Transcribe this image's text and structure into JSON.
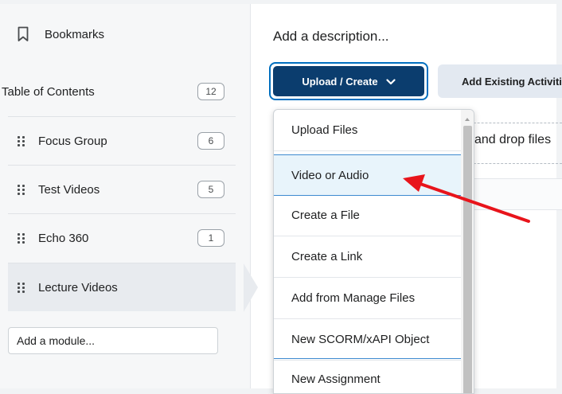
{
  "sidebar": {
    "bookmarks_label": "Bookmarks",
    "toc": {
      "label": "Table of Contents",
      "count": "12"
    },
    "modules": [
      {
        "label": "Focus Group",
        "count": "6"
      },
      {
        "label": "Test Videos",
        "count": "5"
      },
      {
        "label": "Echo 360",
        "count": "1"
      },
      {
        "label": "Lecture Videos",
        "count": ""
      }
    ],
    "add_module_placeholder": "Add a module..."
  },
  "main": {
    "description_placeholder": "Add a description...",
    "upload_create_label": "Upload / Create",
    "add_existing_label": "Add Existing Activities",
    "drop_hint": "and drop files"
  },
  "dropdown": {
    "items": [
      "Upload Files",
      "Video or Audio",
      "Create a File",
      "Create a Link",
      "Add from Manage Files",
      "New SCORM/xAPI Object",
      "New Assignment"
    ],
    "highlighted": "Video or Audio"
  },
  "colors": {
    "primary_button": "#0b3d6e",
    "focus_ring": "#006fbf",
    "annotation_arrow": "#e8141b",
    "highlight_bg": "#e8f4fb"
  },
  "icons": {
    "bookmark": "bookmark-icon",
    "chevron": "chevron-down-icon",
    "drag": "drag-handle-icon",
    "annotation": "red-arrow-icon"
  }
}
